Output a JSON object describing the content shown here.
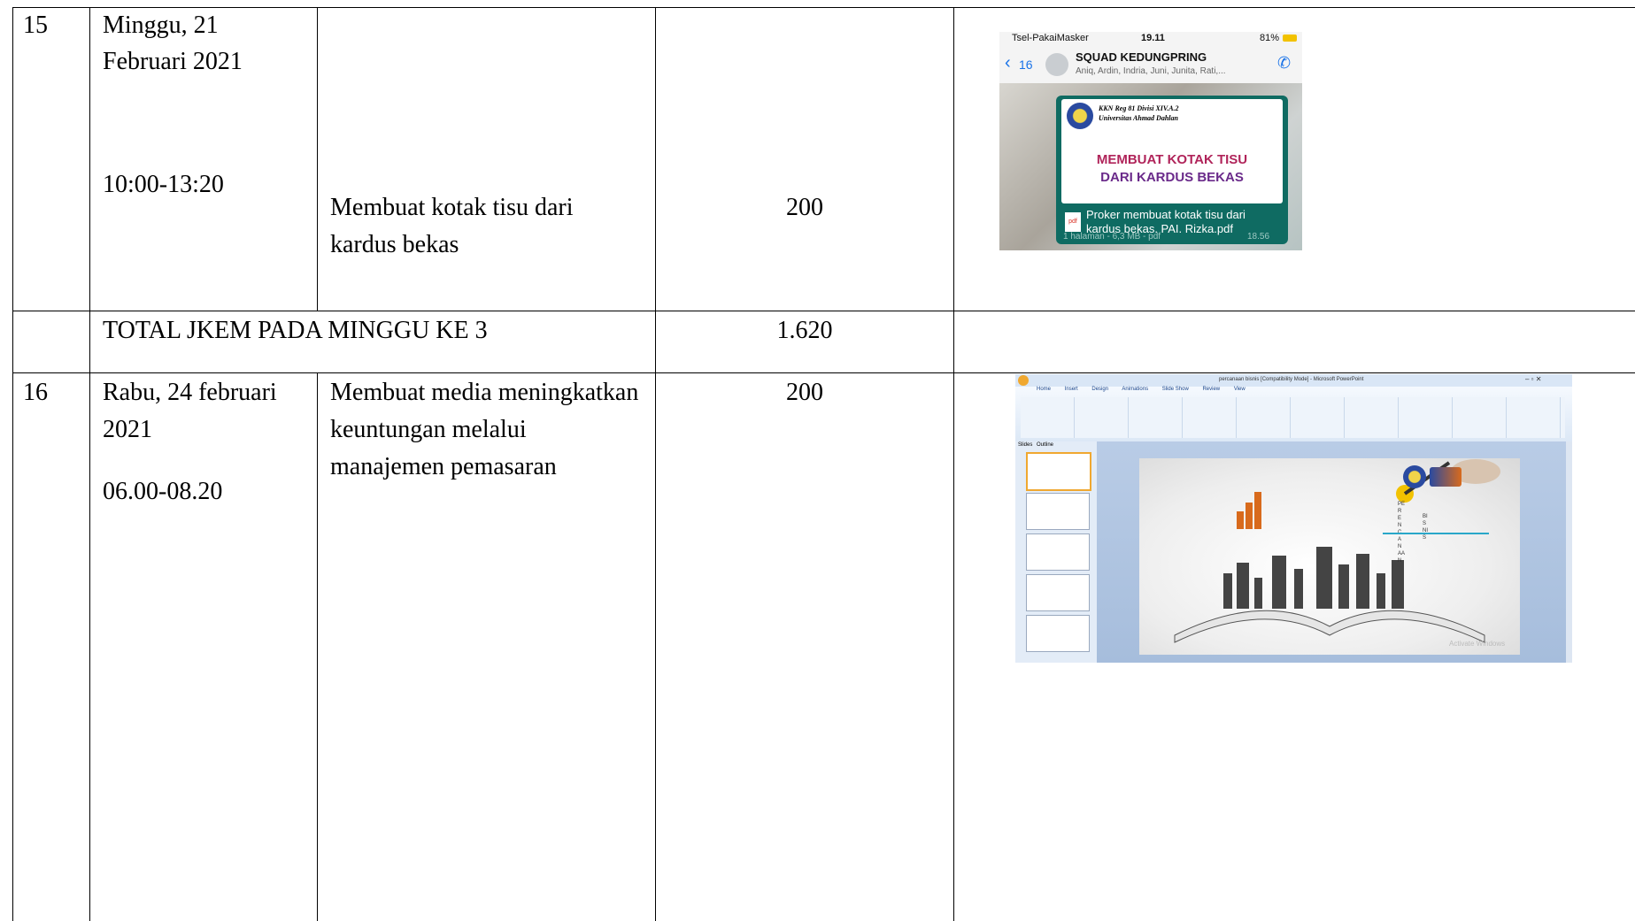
{
  "rows": [
    {
      "no": "15",
      "date_line1": "Minggu, 21",
      "date_line2": "Februari 2021",
      "time": "10:00-13:20",
      "activity": "Membuat kotak tisu dari kardus bekas",
      "jkem": "200"
    },
    {
      "total_label": "TOTAL JKEM PADA MINGGU KE 3",
      "total_value": "1.620"
    },
    {
      "no": "16",
      "date_line1": "Rabu, 24 februari",
      "date_line2": "2021",
      "time": "06.00-08.20",
      "activity": "Membuat media meningkatkan keuntungan melalui manajemen pemasaran",
      "jkem": "200"
    }
  ],
  "screenshot_chat": {
    "carrier": "Tsel-PakaiMasker",
    "time": "19.11",
    "battery": "81%",
    "back_count": "16",
    "group_name": "SQUAD KEDUNGPRING",
    "members": "Aniq, Ardin, Indria, Juni, Junita, Rati,...",
    "org_line1": "KKN Reg 81 Divisi XIV.A.2",
    "org_line2": "Universitas Ahmad Dahlan",
    "headline1": "MEMBUAT KOTAK TISU",
    "headline2": "DARI KARDUS BEKAS",
    "file_icon": "pdf",
    "file_name": "Proker membuat kotak tisu dari kardus bekas. PAI. Rizka.pdf",
    "file_meta": "1 halaman - 6,3 MB - pdf",
    "file_time": "18.56"
  },
  "screenshot_ppt": {
    "window_title": "percanaan bisnis [Compatibility Mode] - Microsoft PowerPoint",
    "tabs": [
      "Home",
      "Insert",
      "Design",
      "Animations",
      "Slide Show",
      "Review",
      "View"
    ],
    "panel_tabs": [
      "Slides",
      "Outline"
    ],
    "slide_vertical_1": "PERENCANAAN",
    "slide_vertical_2": "BISNIS",
    "watermark": "Activate Windows"
  }
}
